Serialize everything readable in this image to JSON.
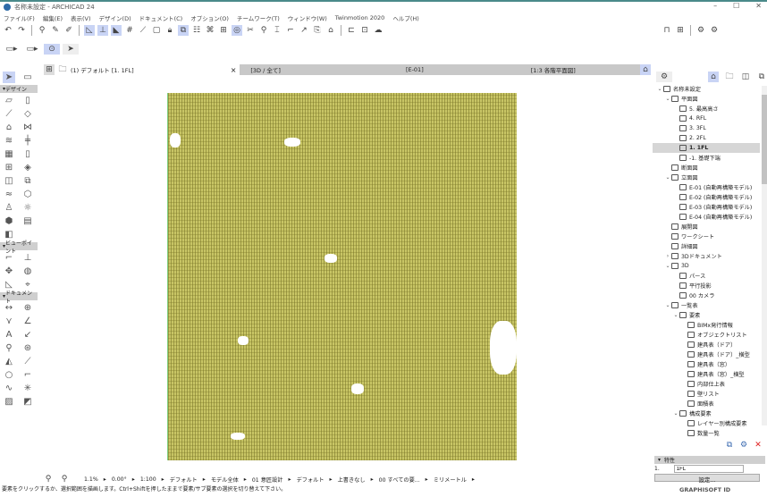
{
  "window": {
    "title": "名称未設定 - ARCHICAD 24",
    "min": "–",
    "max": "☐",
    "close": "✕"
  },
  "menu": [
    "ファイル(F)",
    "編集(E)",
    "表示(V)",
    "デザイン(D)",
    "ドキュメント(C)",
    "オプション(O)",
    "チームワーク(T)",
    "ウィンドウ(W)",
    "Twinmotion 2020",
    "ヘルプ(H)"
  ],
  "tabs": {
    "active": "(1) デフォルト [1. 1FL]",
    "close": "×",
    "t1": "[3D / 全て]",
    "t2": "[E-01]",
    "t3": "[1:3 各階平面図]"
  },
  "palette": {
    "design": "デザイン",
    "viewpoint": "ビューポイント",
    "document": "ドキュメント"
  },
  "navigator": {
    "items": [
      {
        "label": "名称未設定",
        "indent": 0,
        "arrow": "⌄"
      },
      {
        "label": "平面図",
        "indent": 1,
        "arrow": "⌄"
      },
      {
        "label": "5. 最高高さ",
        "indent": 2
      },
      {
        "label": "4. RFL",
        "indent": 2
      },
      {
        "label": "3. 3FL",
        "indent": 2
      },
      {
        "label": "2. 2FL",
        "indent": 2
      },
      {
        "label": "1. 1FL",
        "indent": 2,
        "selected": true
      },
      {
        "label": "-1. 基礎下端",
        "indent": 2
      },
      {
        "label": "断面図",
        "indent": 1
      },
      {
        "label": "立面図",
        "indent": 1,
        "arrow": "⌄"
      },
      {
        "label": "E-01 (自動再構築モデル)",
        "indent": 2
      },
      {
        "label": "E-02 (自動再構築モデル)",
        "indent": 2
      },
      {
        "label": "E-03 (自動再構築モデル)",
        "indent": 2
      },
      {
        "label": "E-04 (自動再構築モデル)",
        "indent": 2
      },
      {
        "label": "展開図",
        "indent": 1
      },
      {
        "label": "ワークシート",
        "indent": 1
      },
      {
        "label": "詳細図",
        "indent": 1
      },
      {
        "label": "3Dドキュメント",
        "indent": 1,
        "arrow": "›"
      },
      {
        "label": "3D",
        "indent": 1,
        "arrow": "⌄"
      },
      {
        "label": "パース",
        "indent": 2
      },
      {
        "label": "平行投影",
        "indent": 2
      },
      {
        "label": "00 カメラ",
        "indent": 2
      },
      {
        "label": "一覧表",
        "indent": 1,
        "arrow": "⌄"
      },
      {
        "label": "要素",
        "indent": 2,
        "arrow": "⌄"
      },
      {
        "label": "BIMx発行情報",
        "indent": 3
      },
      {
        "label": "オブジェクトリスト",
        "indent": 3
      },
      {
        "label": "建具表（ドア）",
        "indent": 3
      },
      {
        "label": "建具表（ドア）_横型",
        "indent": 3
      },
      {
        "label": "建具表（窓）",
        "indent": 3
      },
      {
        "label": "建具表（窓）_横型",
        "indent": 3
      },
      {
        "label": "内部仕上表",
        "indent": 3
      },
      {
        "label": "壁リスト",
        "indent": 3
      },
      {
        "label": "面積表",
        "indent": 3
      },
      {
        "label": "構成要素",
        "indent": 2,
        "arrow": "⌄"
      },
      {
        "label": "レイヤー別構成要素",
        "indent": 3
      },
      {
        "label": "数量一覧",
        "indent": 3
      }
    ]
  },
  "properties": {
    "header": "特性",
    "id": "1.",
    "name_value": "1FL",
    "settings": "設定..."
  },
  "status": {
    "zoom": "1.1%",
    "angle": "0.00°",
    "scale": "1:100",
    "layer_combo": "デフォルト",
    "model_view": "モデル全体",
    "renovation": "01 意匠設計",
    "pen_set": "デフォルト",
    "override": "上書きなし",
    "filter": "00 すべての要...",
    "unit": "ミリメートル",
    "message": "要素をクリックするか、選択範囲を描画します。Ctrl+Shiftを押したままで要素/サブ要素の選択を切り替えて下さい。"
  },
  "brand": "GRAPHISOFT ID"
}
